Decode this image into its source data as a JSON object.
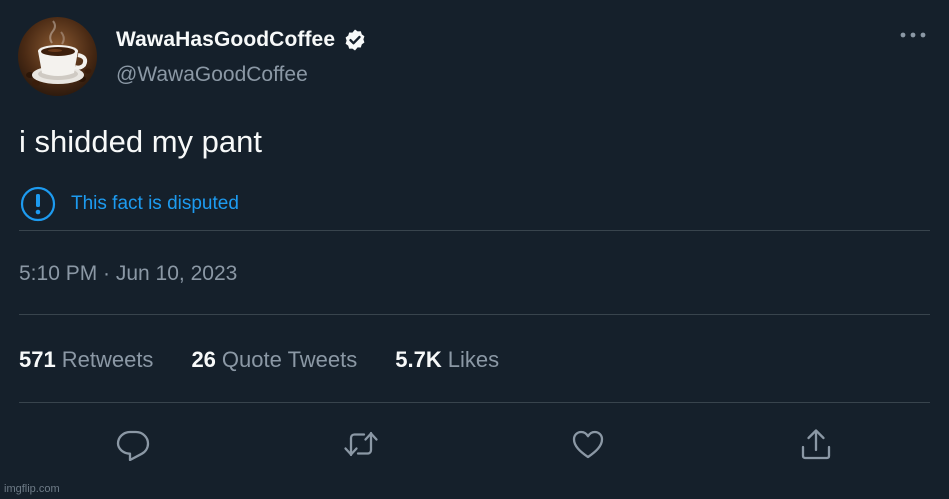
{
  "user": {
    "display_name": "WawaHasGoodCoffee",
    "handle": "@WawaGoodCoffee",
    "avatar_icon": "coffee-cup-avatar",
    "verified": true
  },
  "tweet": {
    "text": "i shidded my pant",
    "notice": "This fact is disputed",
    "timestamp": "5:10 PM · Jun 10, 2023"
  },
  "stats": [
    {
      "count": "571",
      "label": "Retweets"
    },
    {
      "count": "26",
      "label": "Quote Tweets"
    },
    {
      "count": "5.7K",
      "label": "Likes"
    }
  ],
  "actions": [
    "reply-icon",
    "retweet-icon",
    "like-icon",
    "share-icon"
  ],
  "watermark": "imgflip.com",
  "colors": {
    "background": "#15202b",
    "accent": "#1d9bf0",
    "secondary_text": "#8b98a5",
    "divider": "#38444d"
  }
}
